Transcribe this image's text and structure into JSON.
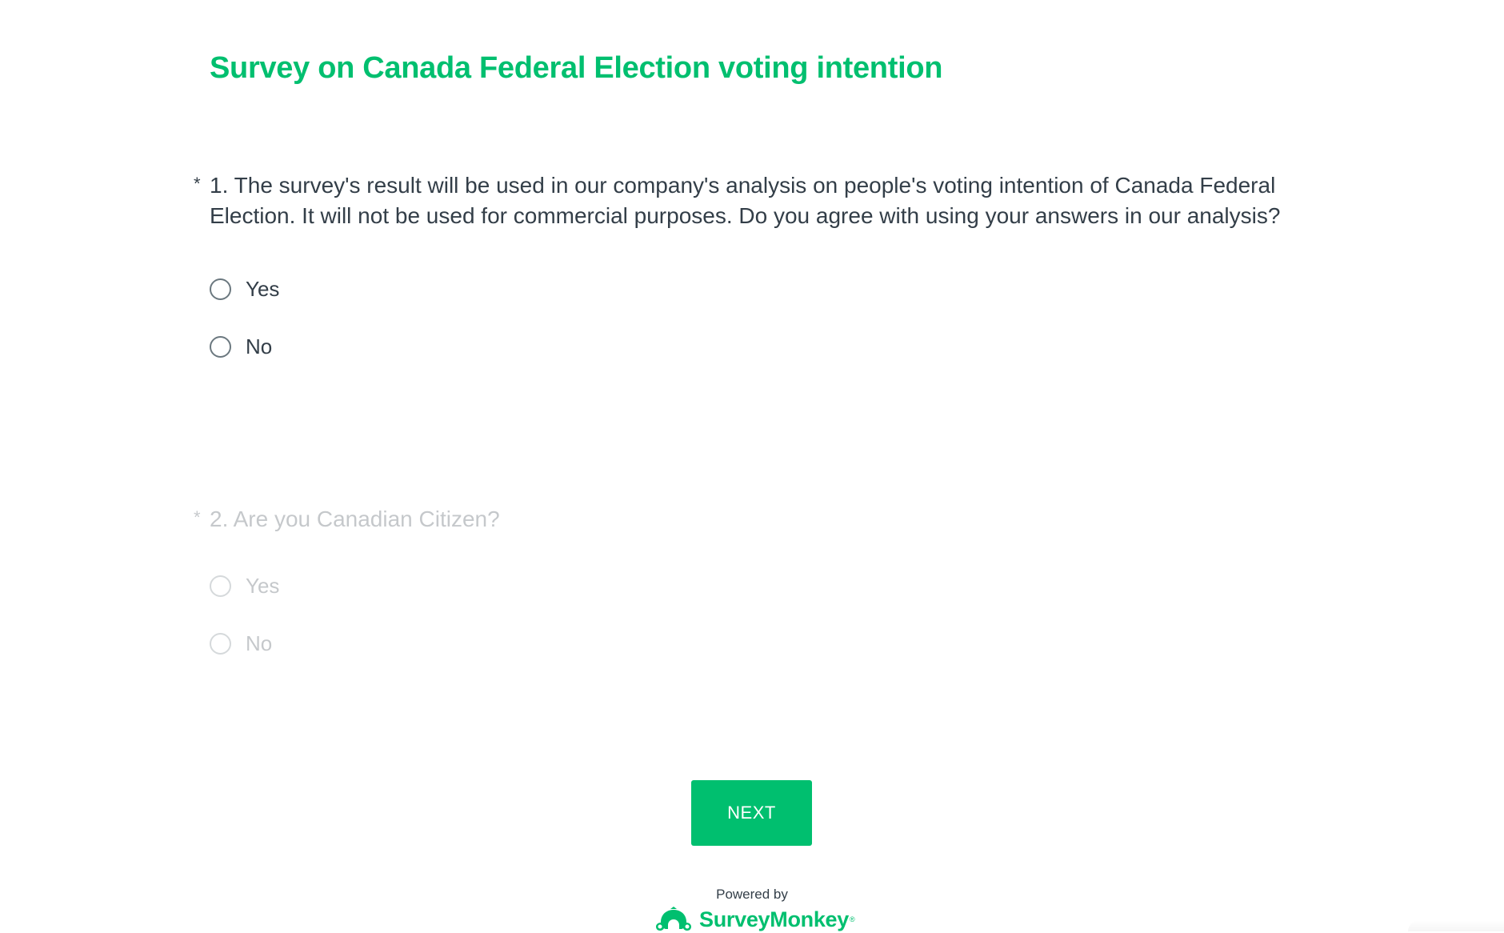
{
  "survey": {
    "title": "Survey on Canada Federal Election voting intention"
  },
  "questions": [
    {
      "required_marker": "*",
      "number": "1.",
      "text": "The survey's result will be used in our company's analysis on people's voting intention of Canada Federal Election. It will not be used for commercial purposes. Do you agree with using your answers in our analysis?",
      "enabled": true,
      "choices": [
        {
          "label": "Yes",
          "selected": false
        },
        {
          "label": "No",
          "selected": false
        }
      ]
    },
    {
      "required_marker": "*",
      "number": "2.",
      "text": "Are you Canadian Citizen?",
      "enabled": false,
      "choices": [
        {
          "label": "Yes",
          "selected": false
        },
        {
          "label": "No",
          "selected": false
        }
      ]
    }
  ],
  "footer": {
    "next_label": "NEXT",
    "powered_by": "Powered by",
    "brand_name": "SurveyMonkey",
    "brand_registered": "®"
  },
  "colors": {
    "accent": "#00bf6f",
    "text": "#333e48",
    "radio_border": "#6b787f"
  },
  "icons": {
    "brand": "surveymonkey-logo-icon",
    "radio": "radio-unchecked-icon"
  }
}
